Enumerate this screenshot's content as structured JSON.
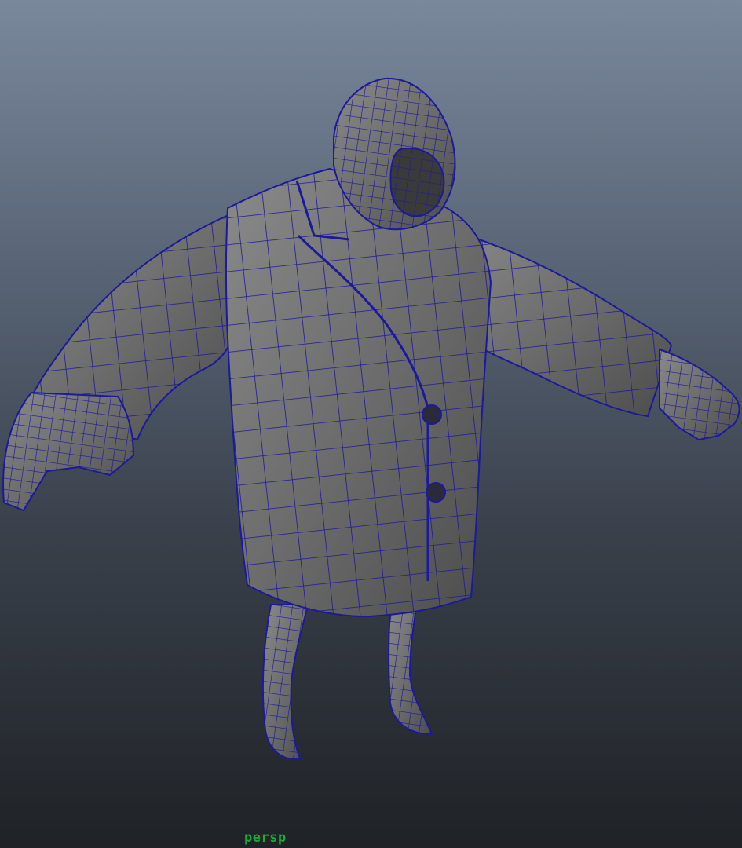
{
  "viewport": {
    "camera_label": "persp",
    "background_top": "#7a889c",
    "background_bottom": "#1f2226",
    "mesh_fill": "#6f6f6f",
    "wireframe_color": "#1a1a9a",
    "label_color": "#1aa83a"
  },
  "model": {
    "description_icon": "hooded-coat-character-wireframe-icon"
  }
}
